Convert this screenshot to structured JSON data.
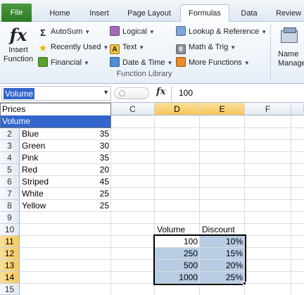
{
  "tabs": [
    "File",
    "Home",
    "Insert",
    "Page Layout",
    "Formulas",
    "Data",
    "Review"
  ],
  "active_tab": "Formulas",
  "ribbon": {
    "insert_function": [
      "Insert",
      "Function"
    ],
    "buttons": {
      "autosum": "AutoSum",
      "recently_used": "Recently Used",
      "financial": "Financial",
      "logical": "Logical",
      "text": "Text",
      "date_time": "Date & Time",
      "lookup": "Lookup & Reference",
      "math": "Math & Trig",
      "more": "More Functions"
    },
    "group_label": "Function Library",
    "name_manager": [
      "Name",
      "Manager"
    ]
  },
  "formula_bar": {
    "name_box_value": "Volume",
    "fx_label": "fx",
    "formula_value": "100"
  },
  "name_list": [
    "Prices",
    "Volume"
  ],
  "columns": [
    "C",
    "D",
    "E",
    "F"
  ],
  "rows": [
    "2",
    "3",
    "4",
    "5",
    "6",
    "7",
    "8",
    "9",
    "10",
    "11",
    "12",
    "13",
    "14",
    "15"
  ],
  "prices_table": [
    {
      "color": "Blue",
      "price": "35"
    },
    {
      "color": "Green",
      "price": "30"
    },
    {
      "color": "Pink",
      "price": "35"
    },
    {
      "color": "Red",
      "price": "20"
    },
    {
      "color": "Striped",
      "price": "45"
    },
    {
      "color": "White",
      "price": "25"
    },
    {
      "color": "Yellow",
      "price": "25"
    }
  ],
  "discount_table": {
    "headers": [
      "Volume",
      "Discount"
    ],
    "rows": [
      {
        "volume": "100",
        "discount": "10%"
      },
      {
        "volume": "250",
        "discount": "15%"
      },
      {
        "volume": "500",
        "discount": "20%"
      },
      {
        "volume": "1000",
        "discount": "25%"
      }
    ]
  },
  "colors": {
    "file_tab": "#2c7a25",
    "selection_fill": "#b8cce4",
    "header_highlight": "#f7c75a",
    "namebox_highlight": "#3266cc"
  }
}
